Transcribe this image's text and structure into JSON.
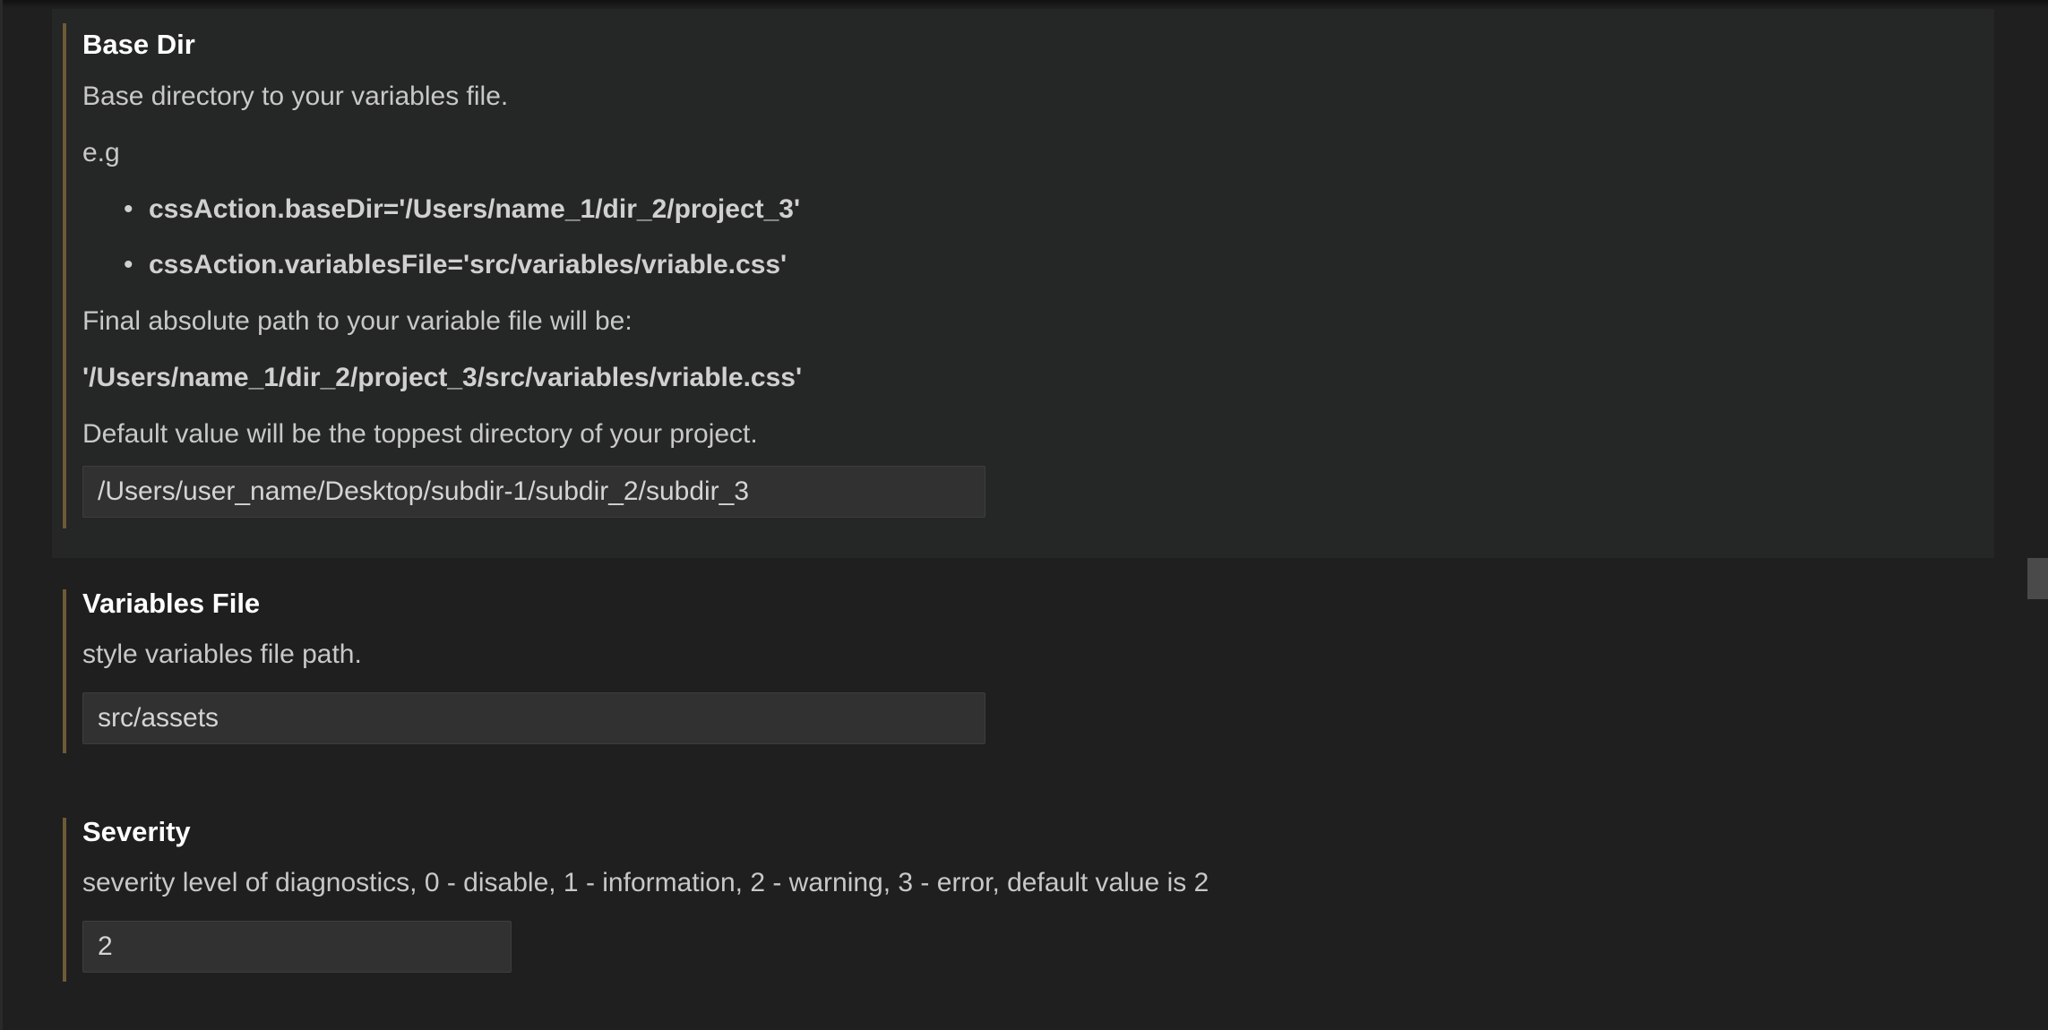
{
  "settings": {
    "base_dir": {
      "title": "Base Dir",
      "description": "Base directory to your variables file.",
      "example_label": "e.g",
      "examples": [
        "cssAction.baseDir='/Users/name_1/dir_2/project_3'",
        "cssAction.variablesFile='src/variables/vriable.css'"
      ],
      "final_path_label": "Final absolute path to your variable file will be:",
      "final_path": "'/Users/name_1/dir_2/project_3/src/variables/vriable.css'",
      "default_note": "Default value will be the toppest directory of your project.",
      "value": "/Users/user_name/Desktop/subdir-1/subdir_2/subdir_3"
    },
    "variables_file": {
      "title": "Variables File",
      "description": "style variables file path.",
      "value": "src/assets"
    },
    "severity": {
      "title": "Severity",
      "description": "severity level of diagnostics, 0 - disable, 1 - information, 2 - warning, 3 - error, default value is 2",
      "value": "2"
    }
  },
  "colors": {
    "background": "#1f1f1f",
    "focused_section": "#252626",
    "modified_indicator": "#6e5a35",
    "input_background": "#313131"
  }
}
